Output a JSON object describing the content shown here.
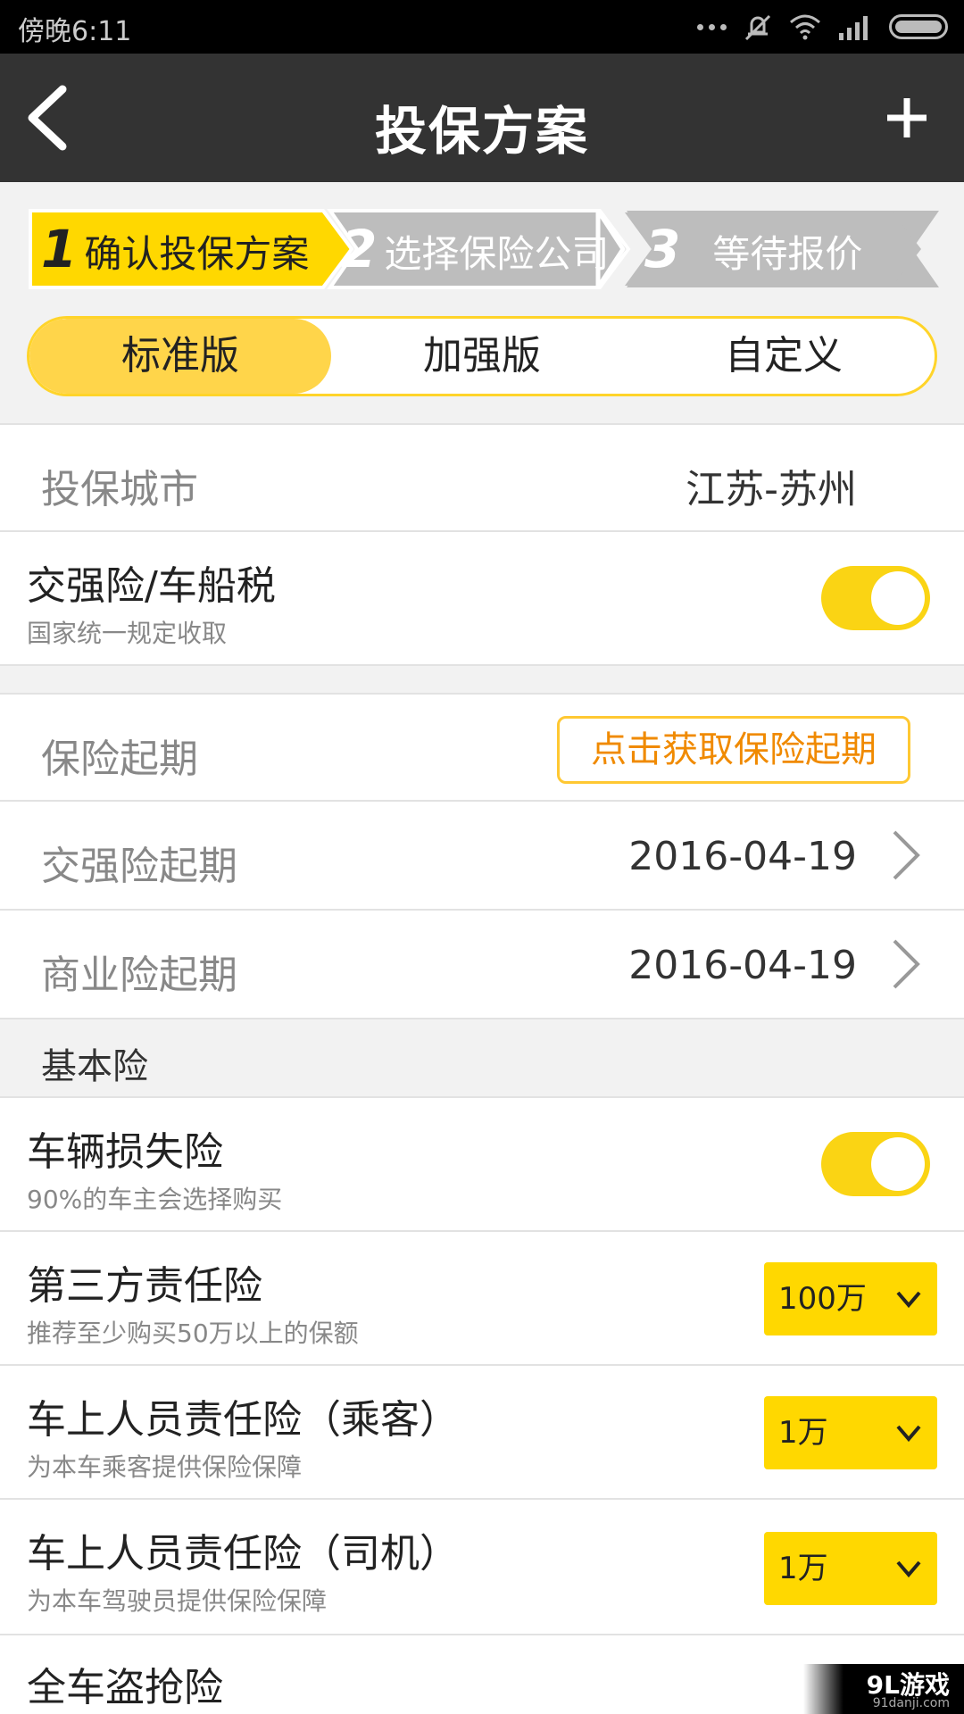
{
  "status_bar": {
    "time": "傍晚6:11"
  },
  "header": {
    "title": "投保方案"
  },
  "steps": [
    {
      "num": "1",
      "label": "确认投保方案"
    },
    {
      "num": "2",
      "label": "选择保险公司"
    },
    {
      "num": "3",
      "label": "等待报价"
    }
  ],
  "plans": [
    "标准版",
    "加强版",
    "自定义"
  ],
  "city": {
    "label": "投保城市",
    "value": "江苏-苏州"
  },
  "compulsory": {
    "title": "交强险/车船税",
    "sub": "国家统一规定收取",
    "on": true
  },
  "start": {
    "label": "保险起期",
    "button": "点击获取保险起期"
  },
  "compulsory_start": {
    "label": "交强险起期",
    "value": "2016-04-19"
  },
  "commercial_start": {
    "label": "商业险起期",
    "value": "2016-04-19"
  },
  "basic_section": "基本险",
  "items": [
    {
      "title": "车辆损失险",
      "sub": "90%的车主会选择购买",
      "type": "toggle",
      "on": true
    },
    {
      "title": "第三方责任险",
      "sub": "推荐至少购买50万以上的保额",
      "type": "dropdown",
      "value": "100万"
    },
    {
      "title": "车上人员责任险（乘客）",
      "sub": "为本车乘客提供保险保障",
      "type": "dropdown",
      "value": "1万"
    },
    {
      "title": "车上人员责任险（司机）",
      "sub": "为本车驾驶员提供保险保障",
      "type": "dropdown",
      "value": "1万"
    },
    {
      "title": "全车盗抢险"
    }
  ],
  "watermark": {
    "brand": "9L游戏",
    "site": "91danji.com"
  },
  "colors": {
    "accent": "#ffd800",
    "header": "#333333",
    "orange": "#f08a00",
    "step_inactive": "#bdbdbd"
  }
}
